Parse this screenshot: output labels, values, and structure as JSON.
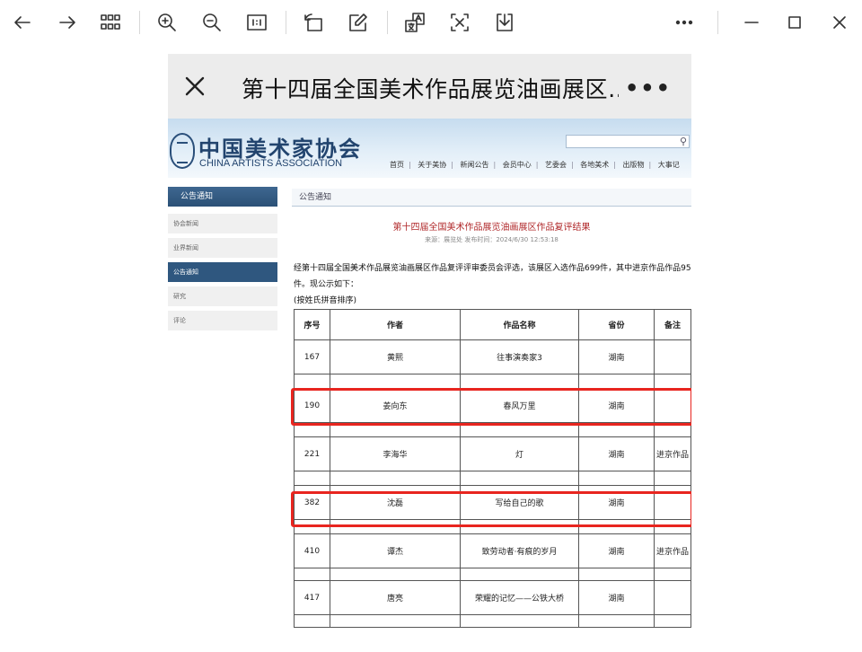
{
  "page": {
    "mobile_title": "第十四届全国美术作品展览油画展区…",
    "more_dots": "•••"
  },
  "site": {
    "logo_cn": "中国美术家协会",
    "logo_en": "CHINA ARTISTS ASSOCIATION",
    "search_placeholder": "",
    "nav": [
      "首页",
      "关于美协",
      "新闻公告",
      "会员中心",
      "艺委会",
      "各地美术",
      "出版物",
      "大事记"
    ]
  },
  "sidebar": {
    "title": "公告通知",
    "items": [
      {
        "label": "协会新闻",
        "active": false
      },
      {
        "label": "业界新闻",
        "active": false
      },
      {
        "label": "公告通知",
        "active": true
      },
      {
        "label": "研究",
        "active": false
      },
      {
        "label": "评论",
        "active": false
      }
    ]
  },
  "article": {
    "breadcrumb": "公告通知",
    "title": "第十四届全国美术作品展览油画展区作品复评结果",
    "meta": "来源：展览处 发布时间：2024/6/30 12:53:18",
    "intro": "经第十四届全国美术作品展览油画展区作品复评评审委员会评选，该展区入选作品699件，其中进京作品作品95件。现公示如下：",
    "note": "(按姓氏拼音排序)"
  },
  "table": {
    "headers": [
      "序号",
      "作者",
      "作品名称",
      "省份",
      "备注"
    ],
    "rows": [
      {
        "no": "167",
        "author": "黄熙",
        "work": "往事演奏家3",
        "province": "湖南",
        "remark": ""
      },
      {
        "no": "190",
        "author": "姜向东",
        "work": "春风万里",
        "province": "湖南",
        "remark": ""
      },
      {
        "no": "221",
        "author": "李海华",
        "work": "灯",
        "province": "湖南",
        "remark": "进京作品"
      },
      {
        "no": "382",
        "author": "沈磊",
        "work": "写给自己的歌",
        "province": "湖南",
        "remark": ""
      },
      {
        "no": "410",
        "author": "谭杰",
        "work": "致劳动者·有痕的岁月",
        "province": "湖南",
        "remark": "进京作品"
      },
      {
        "no": "417",
        "author": "唐亮",
        "work": "荣耀的记忆——公铁大桥",
        "province": "湖南",
        "remark": ""
      }
    ]
  },
  "colors": {
    "highlight": "#e8251f",
    "title_red": "#b0282a",
    "nav_blue": "#2f577f"
  },
  "icons": [
    "back-arrow-icon",
    "forward-arrow-icon",
    "grid-icon",
    "zoom-in-icon",
    "zoom-out-icon",
    "actual-size-icon",
    "rotate-icon",
    "edit-icon",
    "translate-icon",
    "ocr-text-icon",
    "download-icon",
    "more-icon",
    "minimize-icon",
    "maximize-icon",
    "close-icon"
  ]
}
